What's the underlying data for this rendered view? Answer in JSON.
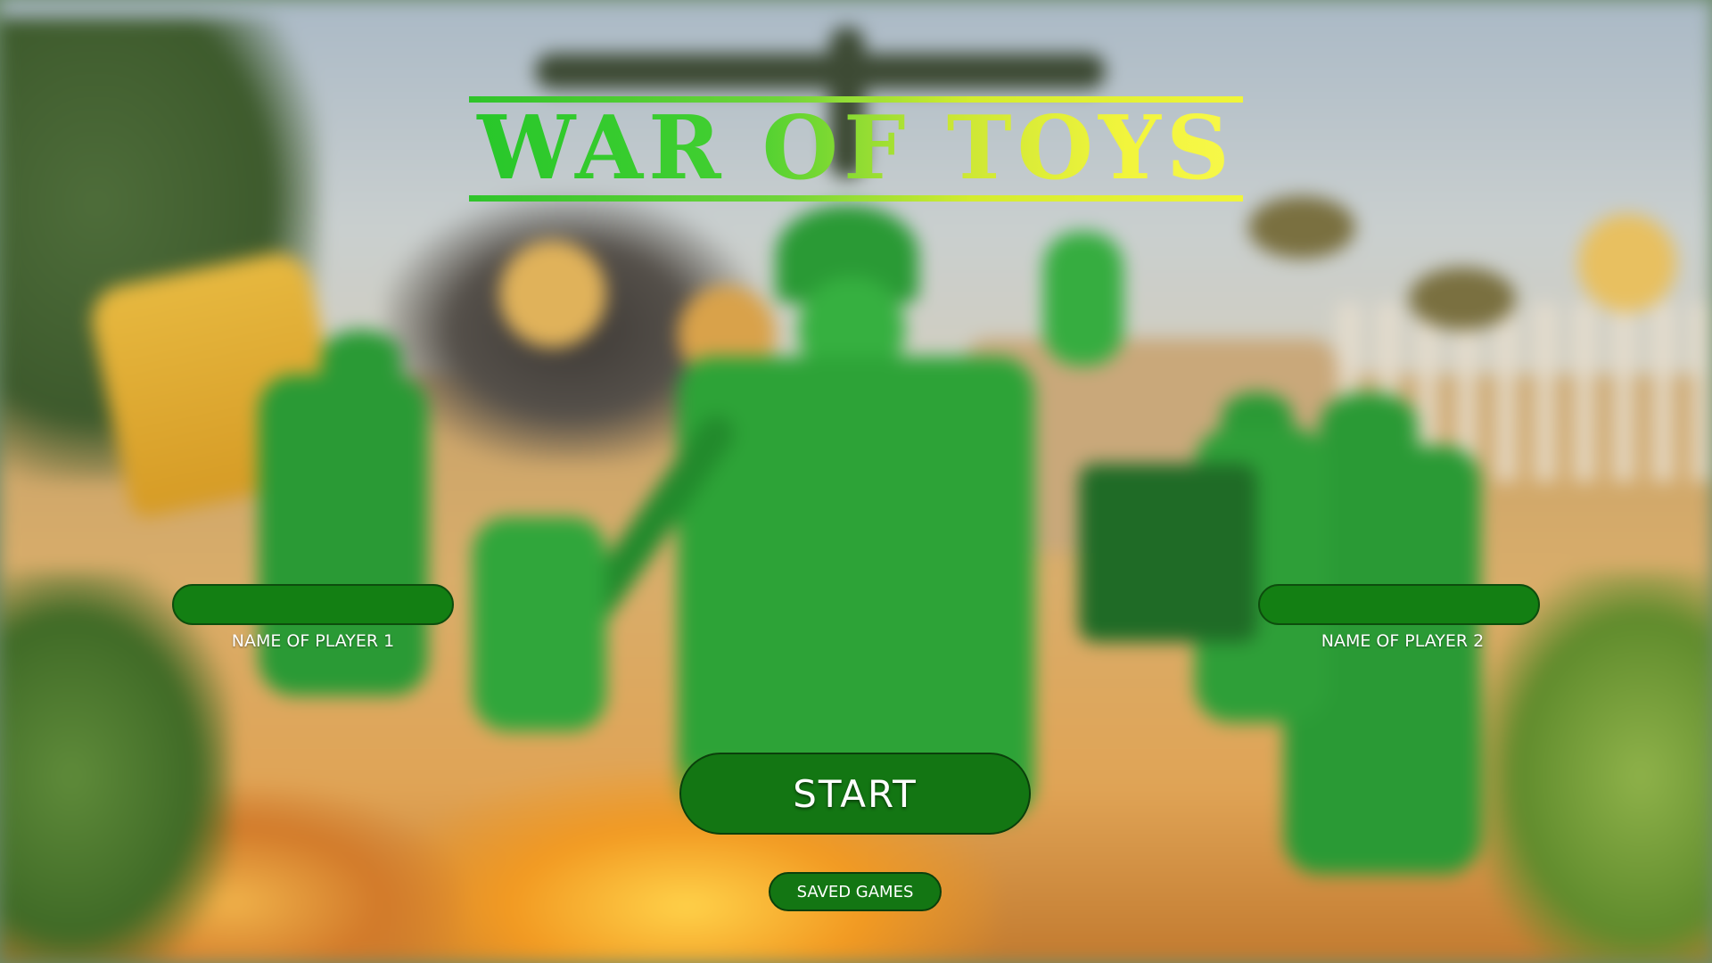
{
  "game": {
    "title": "WAR OF TOYS"
  },
  "players": [
    {
      "label": "NAME OF PLAYER 1",
      "value": "",
      "placeholder": ""
    },
    {
      "label": "NAME OF PLAYER 2",
      "value": "",
      "placeholder": ""
    }
  ],
  "actions": {
    "start_label": "START",
    "saved_games_label": "SAVED GAMES"
  },
  "colors": {
    "button_green": "#137613",
    "title_gradient_start": "#27c72a",
    "title_gradient_end": "#f7f84a"
  }
}
